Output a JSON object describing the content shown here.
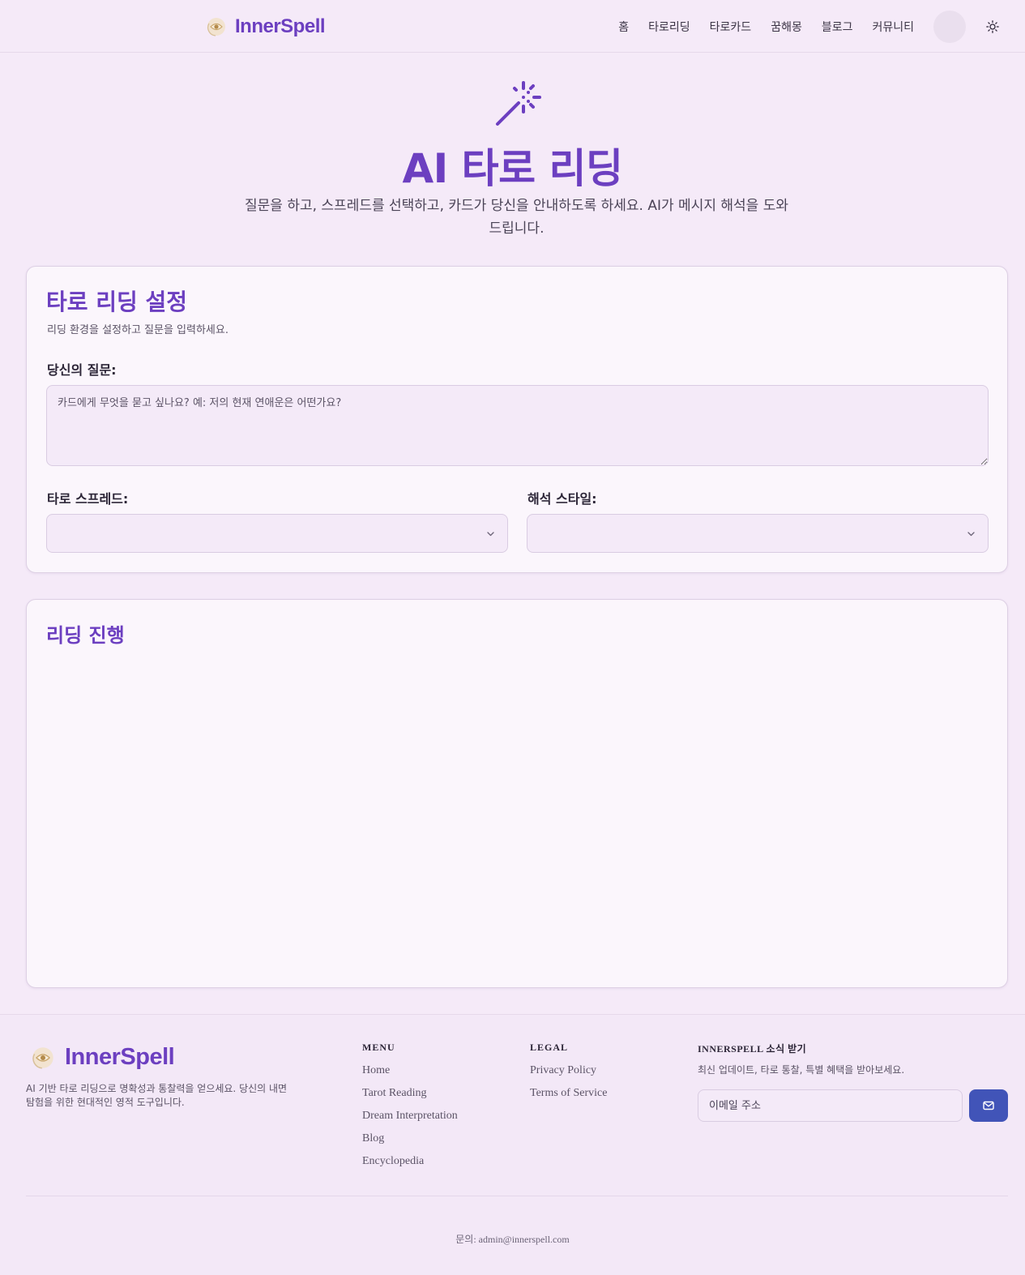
{
  "header": {
    "brand": "InnerSpell",
    "nav": [
      "홈",
      "타로리딩",
      "타로카드",
      "꿈해몽",
      "블로그",
      "커뮤니티"
    ]
  },
  "hero": {
    "title": "AI 타로 리딩",
    "subtitle": "질문을 하고, 스프레드를 선택하고, 카드가 당신을 안내하도록 하세요. AI가 메시지 해석을 도와드립니다."
  },
  "setup": {
    "title": "타로 리딩 설정",
    "description": "리딩 환경을 설정하고 질문을 입력하세요.",
    "question_label": "당신의 질문:",
    "question_placeholder": "카드에게 무엇을 묻고 싶나요? 예: 저의 현재 연애운은 어떤가요?",
    "spread_label": "타로 스프레드:",
    "spread_value": "",
    "style_label": "해석 스타일:",
    "style_value": ""
  },
  "progress": {
    "title": "리딩 진행"
  },
  "footer": {
    "brand": "InnerSpell",
    "description": "AI 기반 타로 리딩으로 명확성과 통찰력을 얻으세요. 당신의 내면 탐험을 위한 현대적인 영적 도구입니다.",
    "menu_title": "MENU",
    "menu_links": [
      "Home",
      "Tarot Reading",
      "Dream Interpretation",
      "Blog",
      "Encyclopedia"
    ],
    "legal_title": "LEGAL",
    "legal_links": [
      "Privacy Policy",
      "Terms of Service"
    ],
    "newsletter_title": "INNERSPELL 소식 받기",
    "newsletter_desc": "최신 업데이트, 타로 통찰, 특별 혜택을 받아보세요.",
    "email_placeholder": "이메일 주소",
    "contact": "문의: admin@innerspell.com"
  },
  "colors": {
    "brand": "#6c3fc0",
    "background": "#f5eaf8",
    "card": "#fbf6fc",
    "send_button": "#4154b8"
  },
  "icons": [
    "eye-moon-logo-icon",
    "sun-icon",
    "magic-wand-icon",
    "chevron-down-icon",
    "mail-icon"
  ]
}
